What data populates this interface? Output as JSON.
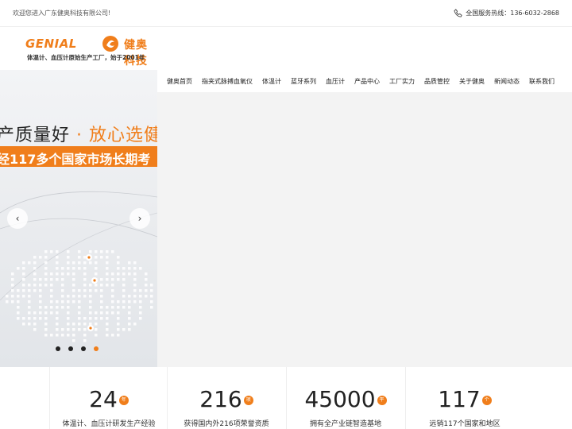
{
  "topbar": {
    "welcome": "欢迎您进入广东健奥科技有限公司!",
    "hotline": "全国服务热线：136-6032-2868"
  },
  "logo": {
    "brand": "GENIAL",
    "company": "健奥科技",
    "slogan": "体温计、血压计原始生产工厂，始于2001年"
  },
  "nav": [
    "健奥首页",
    "指夹式脉搏血氧仪",
    "体温计",
    "蓝牙系列",
    "血压计",
    "产品中心",
    "工厂实力",
    "品质管控",
    "关于健奥",
    "新闻动态",
    "联系我们"
  ],
  "hero": {
    "line1_a": "产质量好",
    "line1_sep": "·",
    "line1_b": "放心选健",
    "line2": "经117多个国家市场长期考",
    "prev": "‹",
    "next": "›",
    "slides": 4,
    "active_slide": 3
  },
  "stats": [
    {
      "value": "24",
      "unit": "年",
      "label": "体温计、血压计研发生产经验"
    },
    {
      "value": "216",
      "unit": "项",
      "label": "获得国内外216项荣誉资质"
    },
    {
      "value": "45000",
      "unit": "平",
      "label": "拥有全产业链智造基地"
    },
    {
      "value": "117",
      "unit": "个",
      "label": "远销117个国家和地区"
    }
  ],
  "colors": {
    "accent": "#f07e1b"
  }
}
